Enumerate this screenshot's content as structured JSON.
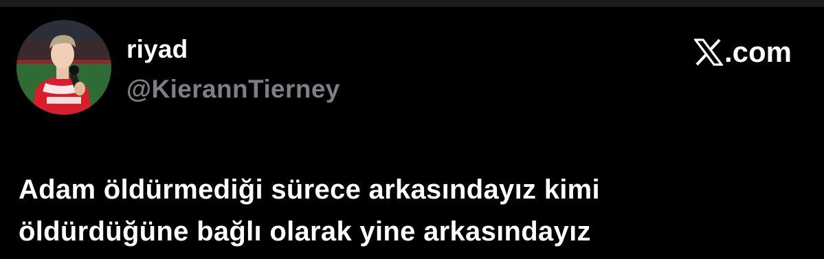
{
  "tweet": {
    "author": {
      "display_name": "riyad",
      "handle": "@KierannTierney",
      "avatar_icon": "profile-photo-football-player"
    },
    "brand": {
      "logo_icon": "x-logo-icon",
      "text": ".com"
    },
    "text_lines": [
      "Adam öldürmediği sürece arkasındayız kimi",
      "öldürdüğüne bağlı olarak yine arkasındayız"
    ]
  },
  "colors": {
    "background": "#000000",
    "primary_text": "#ffffff",
    "secondary_text": "#7c7f84",
    "top_strip": "#1c1c1e"
  }
}
